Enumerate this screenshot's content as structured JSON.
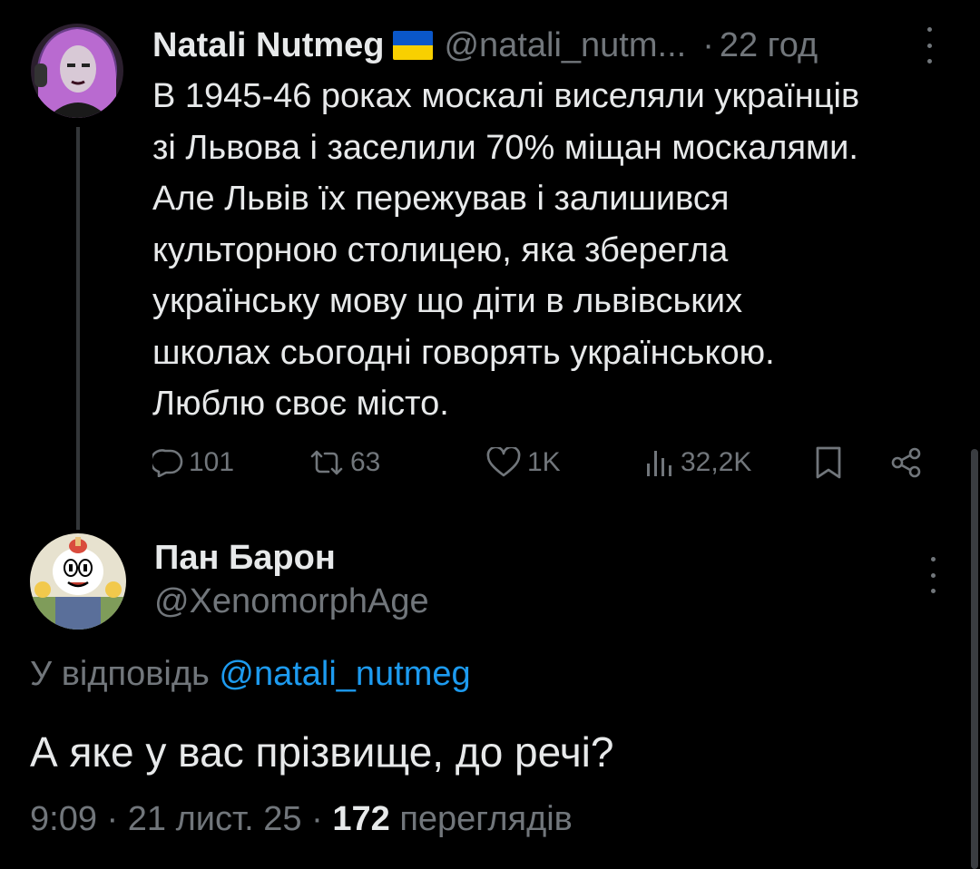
{
  "tweet": {
    "author_name": "Natali Nutmeg",
    "author_handle": "@natali_nutm...",
    "separator": "·",
    "time_ago": "22 год",
    "lines": [
      "В 1945-46 роках москалі виселяли українців",
      "зі Львова і заселили 70% міщан москалями.",
      "Але Львів їх пережував і залишився",
      "культорною столицею, яка зберегла",
      "українську мову що діти в львівських",
      "школах сьогодні говорять українською.",
      "Люблю своє місто."
    ],
    "stats": {
      "replies": "101",
      "reposts": "63",
      "likes": "1K",
      "views": "32,2K"
    }
  },
  "reply": {
    "author_name": "Пан Барон",
    "author_handle": "@XenomorphAge",
    "reply_to_prefix": "У відповідь ",
    "reply_to_handle": "@natali_nutmeg",
    "text": "А яке у вас прізвище, до речі?",
    "time": "9:09",
    "date": "21 лист. 25",
    "views_count": "172",
    "views_label": "переглядів"
  },
  "colors": {
    "background": "#000000",
    "text": "#e7e9ea",
    "muted": "#71767b",
    "link": "#1d9bf0"
  }
}
